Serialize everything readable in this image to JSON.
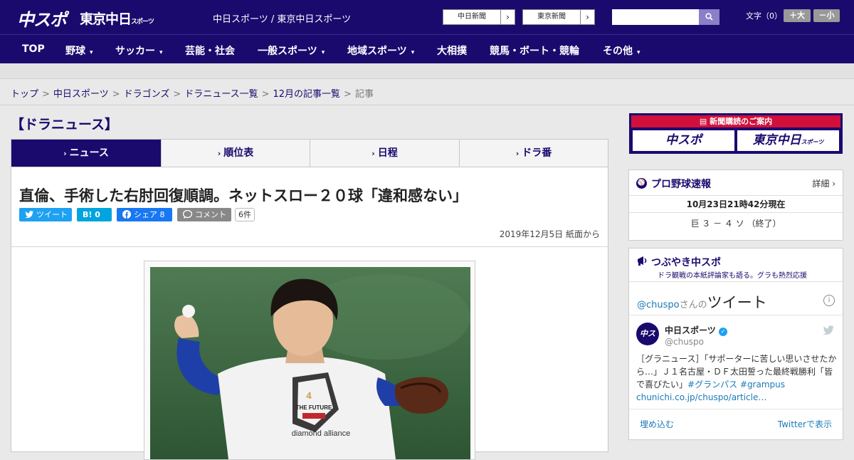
{
  "header": {
    "logo_chuspo": "中スポ",
    "logo_tokyo": "東京中日",
    "logo_tokyo_sub": "スポーツ",
    "site_title": "中日スポーツ / 東京中日スポーツ",
    "link_chunichi": "中日新聞",
    "link_tokyo": "東京新聞",
    "font_label": "文字（0）",
    "font_large": "＋大",
    "font_small": "－小",
    "brand_color": "#1a0a6e"
  },
  "nav": [
    "TOP",
    "野球",
    "サッカー",
    "芸能・社会",
    "一般スポーツ",
    "地域スポーツ",
    "大相撲",
    "競馬・ボート・競輪",
    "その他"
  ],
  "breadcrumb": [
    "トップ",
    "中日スポーツ",
    "ドラゴンズ",
    "ドラニュース一覧",
    "12月の記事一覧",
    "記事"
  ],
  "category_title": "【ドラニュース】",
  "tabs": [
    "ニュース",
    "順位表",
    "日程",
    "ドラ番"
  ],
  "article": {
    "headline": "直倫、手術した右肘回復順調。ネットスロー２０球「違和感ない」",
    "share_tweet": "ツイート",
    "share_hatena": "0",
    "share_facebook": "シェア 8",
    "share_comment": "コメント",
    "comment_count": "6件",
    "date": "2019年12月5日 紙面から"
  },
  "photo": {
    "shirt_number": "4",
    "shirt_text": "THE FUTURE",
    "shirt_brand": "diamond alliance"
  },
  "sidebar": {
    "ad_title": "新聞購読のご案内",
    "ad_left": "中スポ",
    "ad_right": "東京中日",
    "ad_right_sub": "スポーツ",
    "baseball_title": "プロ野球速報",
    "baseball_more": "詳細 ›",
    "baseball_time": "10月23日21時42分現在",
    "baseball_score": "巨 ３ － ４ ソ （終了）",
    "tweet_title": "つぶやき中スポ",
    "tweet_sub": "ドラ観戦の本紙評論家も語る。グラも熱烈応援",
    "tweet_handle_prefix": "@chuspo",
    "tweet_handle_mid": "さんの",
    "tweet_handle_word": "ツイート",
    "account_name": "中日スポーツ",
    "account_handle": "@chuspo",
    "tweet_text": "［グラニュース］「サポーターに苦しい思いさせたから…」Ｊ１名古屋・ＤＦ太田誓った最終戦勝利「皆で喜びたい」",
    "tweet_tags": "#グランパス #grampus",
    "tweet_link": "chunichi.co.jp/chuspo/article…",
    "embed": "埋め込む",
    "view_on": "Twitterで表示"
  }
}
